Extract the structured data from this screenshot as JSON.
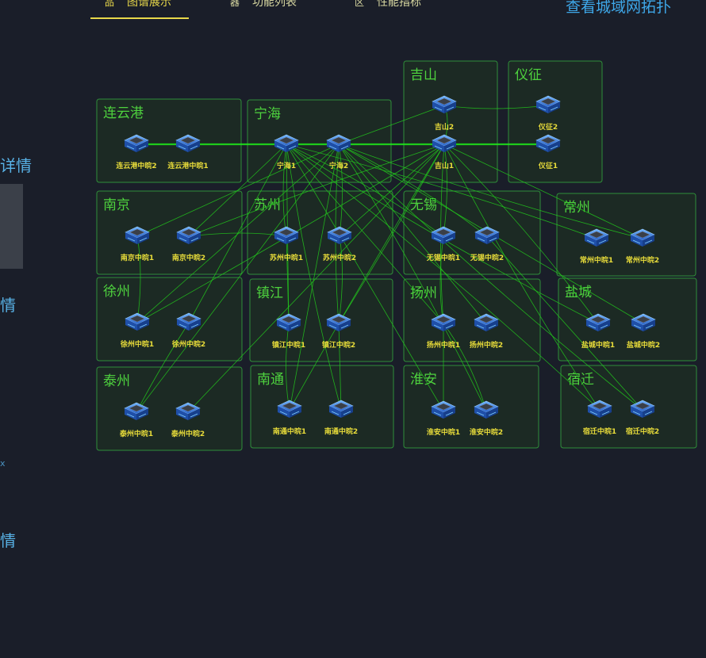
{
  "tabs": [
    {
      "label": "图谱展示",
      "icon": "品",
      "active": true
    },
    {
      "label": "功能列表",
      "icon": "器",
      "active": false
    },
    {
      "label": "性能指标",
      "icon": "区",
      "active": false
    }
  ],
  "topology_link": "查看城域网拓扑",
  "sidebar": {
    "items": [
      {
        "label": "详情"
      },
      {
        "label": "情"
      },
      {
        "label": "情"
      }
    ],
    "small_label": "x"
  },
  "colors": {
    "background": "#1a1e29",
    "region_fill": "#1c2a24",
    "region_border": "#2f8f3a",
    "region_title": "#4ed23e",
    "node_label": "#e8dc3a",
    "edge": "#22c81c",
    "tab_active": "#e8d84a",
    "link": "#3ea7e8"
  },
  "regions": [
    {
      "id": "lianyungang",
      "name": "连云港",
      "nodes": [
        {
          "id": "lyg2",
          "label": "连云港中晥2"
        },
        {
          "id": "lyg1",
          "label": "连云港中晥1"
        }
      ]
    },
    {
      "id": "ninghai",
      "name": "宁海",
      "nodes": [
        {
          "id": "nh1",
          "label": "宁海1"
        },
        {
          "id": "nh2",
          "label": "宁海2"
        }
      ]
    },
    {
      "id": "jishan",
      "name": "吉山",
      "nodes": [
        {
          "id": "js2",
          "label": "吉山2"
        },
        {
          "id": "js1",
          "label": "吉山1"
        }
      ]
    },
    {
      "id": "yizheng",
      "name": "仪征",
      "nodes": [
        {
          "id": "yz2",
          "label": "仪征2"
        },
        {
          "id": "yz1",
          "label": "仪征1"
        }
      ]
    },
    {
      "id": "nanjing",
      "name": "南京",
      "nodes": [
        {
          "id": "nj1",
          "label": "南京中晥1"
        },
        {
          "id": "nj2",
          "label": "南京中晥2"
        }
      ]
    },
    {
      "id": "suzhou",
      "name": "苏州",
      "nodes": [
        {
          "id": "sz1",
          "label": "苏州中晥1"
        },
        {
          "id": "sz2",
          "label": "苏州中晥2"
        }
      ]
    },
    {
      "id": "wuxi",
      "name": "无锡",
      "nodes": [
        {
          "id": "wx1",
          "label": "无锡中晥1"
        },
        {
          "id": "wx2",
          "label": "无锡中晥2"
        }
      ]
    },
    {
      "id": "changzhou",
      "name": "常州",
      "nodes": [
        {
          "id": "cz1",
          "label": "常州中晥1"
        },
        {
          "id": "cz2",
          "label": "常州中晥2"
        }
      ]
    },
    {
      "id": "xuzhou",
      "name": "徐州",
      "nodes": [
        {
          "id": "xz1",
          "label": "徐州中晥1"
        },
        {
          "id": "xz2",
          "label": "徐州中晥2"
        }
      ]
    },
    {
      "id": "zhenjiang",
      "name": "镇江",
      "nodes": [
        {
          "id": "zj1",
          "label": "镇江中晥1"
        },
        {
          "id": "zj2",
          "label": "镇江中晥2"
        }
      ]
    },
    {
      "id": "yangzhou",
      "name": "扬州",
      "nodes": [
        {
          "id": "yzh1",
          "label": "扬州中晥1"
        },
        {
          "id": "yzh2",
          "label": "扬州中晥2"
        }
      ]
    },
    {
      "id": "yancheng",
      "name": "盐城",
      "nodes": [
        {
          "id": "yc1",
          "label": "盐城中晥1"
        },
        {
          "id": "yc2",
          "label": "盐城中晥2"
        }
      ]
    },
    {
      "id": "taizhou",
      "name": "泰州",
      "nodes": [
        {
          "id": "tz1",
          "label": "泰州中晥1"
        },
        {
          "id": "tz2",
          "label": "泰州中晥2"
        }
      ]
    },
    {
      "id": "nantong",
      "name": "南通",
      "nodes": [
        {
          "id": "nt1",
          "label": "南通中晥1"
        },
        {
          "id": "nt2",
          "label": "南通中晥2"
        }
      ]
    },
    {
      "id": "huaian",
      "name": "淮安",
      "nodes": [
        {
          "id": "ha1",
          "label": "淮安中晥1"
        },
        {
          "id": "ha2",
          "label": "淮安中晥2"
        }
      ]
    },
    {
      "id": "suqian",
      "name": "宿迁",
      "nodes": [
        {
          "id": "sq1",
          "label": "宿迁中晥1"
        },
        {
          "id": "sq2",
          "label": "宿迁中晥2"
        }
      ]
    }
  ]
}
